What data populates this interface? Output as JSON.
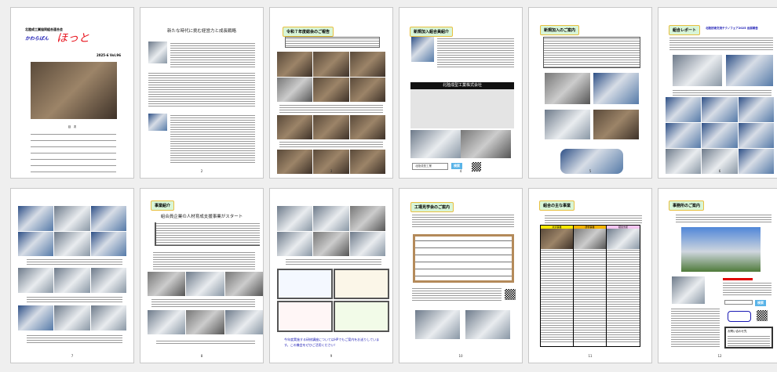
{
  "pages": [
    {
      "num": "1",
      "org": "北陸成工業協同組合連合会",
      "title_a": "かわらばん",
      "title_b": "ほっと",
      "issue": "2025-6  Vol.96",
      "toc_title": "目　次"
    },
    {
      "num": "2",
      "heading": "新たな時代に挑む経営力と成長戦略"
    },
    {
      "num": "3",
      "tag": "令和７年度総会のご報告"
    },
    {
      "num": "4",
      "tag": "新規加入組合員紹介",
      "company": "北陸成型工業株式会社",
      "search_value": "北陸成型工業",
      "search_button": "検索"
    },
    {
      "num": "5",
      "tag": "新規加入のご案内"
    },
    {
      "num": "6",
      "tag": "組合レポート",
      "subtitle": "北陸技術交流テクノフェア2025 出展報告"
    },
    {
      "num": "7"
    },
    {
      "num": "8",
      "tag": "事業紹介",
      "heading": "組合員企業の人材育成支援事業がスタート"
    },
    {
      "num": "9",
      "notice": "今年度実施する研修講座についてはHPでもご案内をお送りしています。この機会をぜひご活用ください！"
    },
    {
      "num": "10",
      "tag": "工場見学会のご案内"
    },
    {
      "num": "11",
      "tag": "組合の主な事業",
      "cols": [
        "共済事業",
        "研修事業",
        "経営支援"
      ]
    },
    {
      "num": "12",
      "tag": "事務所のご案内",
      "search_button": "検索",
      "contact_title": "お問い合わせ先"
    }
  ],
  "colors": {
    "tag_bg": "#d8f5d8",
    "tag_border": "#e8c040",
    "blue_title": "#1a1ab4",
    "red_title": "#e8141e"
  }
}
